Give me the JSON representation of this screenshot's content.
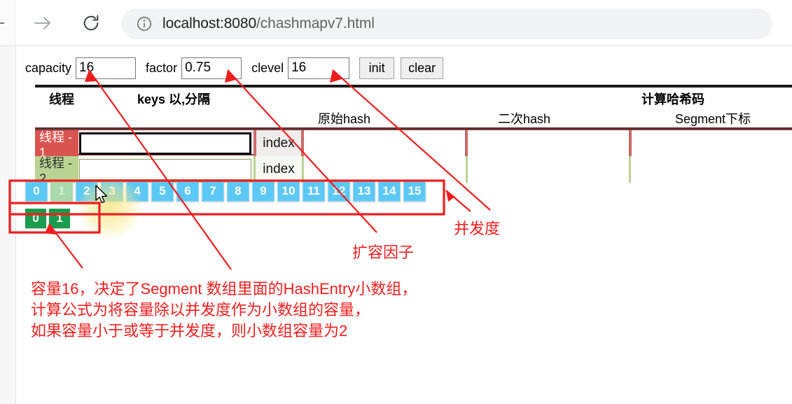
{
  "browser": {
    "url_host": "localhost:8080",
    "url_path": "/chashmapv7.html",
    "back_icon": "back-arrow-icon",
    "forward_icon": "forward-arrow-icon",
    "reload_icon": "reload-icon",
    "info_icon": "info-circle-icon"
  },
  "controls": {
    "capacity_label": "capacity",
    "capacity_value": "16",
    "factor_label": "factor",
    "factor_value": "0.75",
    "clevel_label": "clevel",
    "clevel_value": "16",
    "init_button": "init",
    "clear_button": "clear"
  },
  "table": {
    "header_thread": "线程",
    "header_keys": "keys 以,分隔",
    "header_hashcode": "计算哈希码",
    "header_orig_hash": "原始hash",
    "header_second_hash": "二次hash",
    "header_segment_index": "Segment下标",
    "rows": [
      {
        "thread": "线程 - 1",
        "keys_value": "",
        "keys_placeholder": "",
        "index_label": "index",
        "orig_hash": "",
        "second_hash": "",
        "segment_index": ""
      },
      {
        "thread": "线程 - 2",
        "keys_value": "",
        "keys_placeholder": "",
        "index_label": "index",
        "orig_hash": "",
        "second_hash": "",
        "segment_index": ""
      }
    ]
  },
  "segments": {
    "boxes": [
      "0",
      "1",
      "2",
      "3",
      "4",
      "5",
      "6",
      "7",
      "8",
      "9",
      "10",
      "11",
      "12",
      "13",
      "14",
      "15"
    ],
    "hovered_index": 1,
    "box_color": "#5bc8f5",
    "hover_color": "#a9d9ac"
  },
  "hash_entries": {
    "boxes": [
      "0",
      "1"
    ],
    "box_color": "#1a9c4c"
  },
  "annotations": {
    "accent_color": "#f01d1d",
    "concurrency": "并发度",
    "load_factor": "扩容因子",
    "note_line1": "容量16，决定了Segment 数组里面的HashEntry小数组，",
    "note_line2": "计算公式为将容量除以并发度作为小数组的容量，",
    "note_line3": "如果容量小于或等于并发度，则小数组容量为2"
  }
}
